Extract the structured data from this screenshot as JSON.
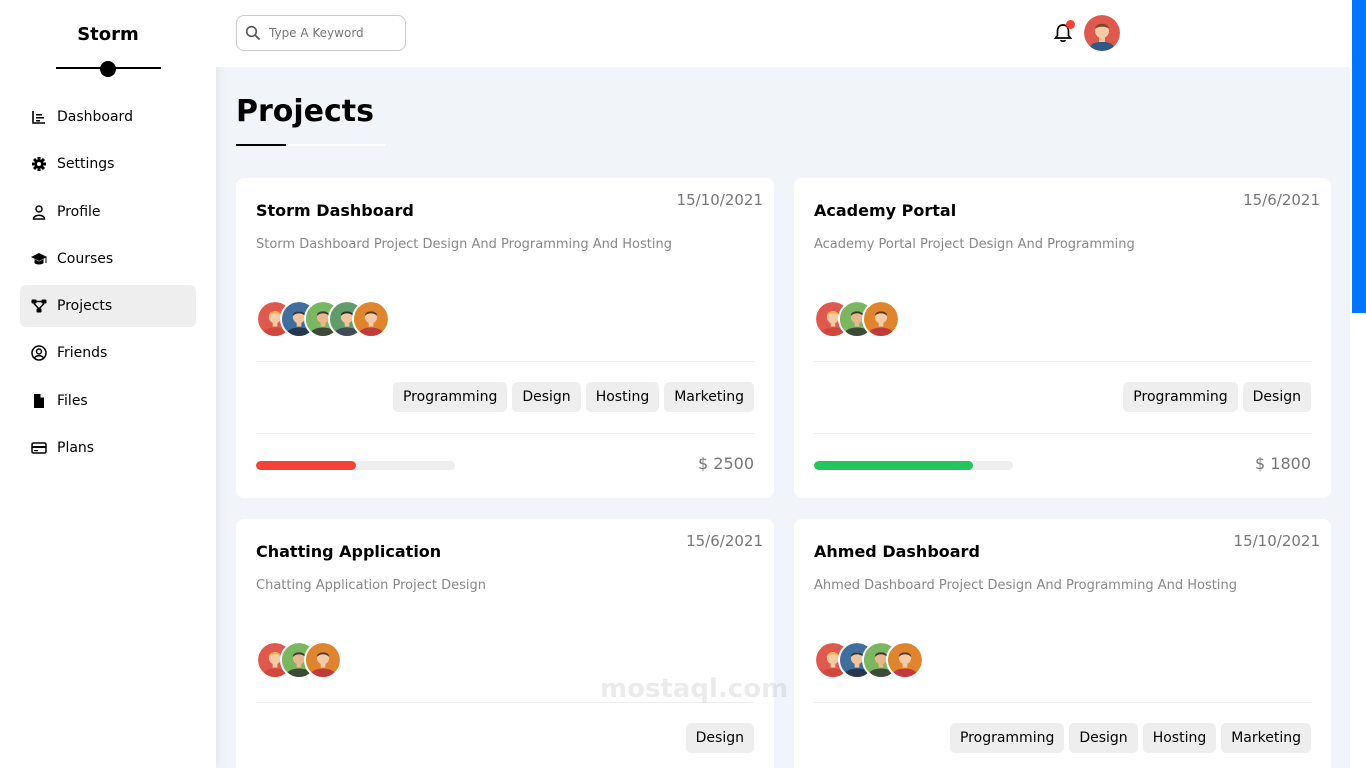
{
  "sidebar": {
    "brand": "Storm",
    "items": [
      {
        "label": "Dashboard",
        "icon": "chart-icon",
        "active": false
      },
      {
        "label": "Settings",
        "icon": "gear-icon",
        "active": false
      },
      {
        "label": "Profile",
        "icon": "user-icon",
        "active": false
      },
      {
        "label": "Courses",
        "icon": "graduation-cap-icon",
        "active": false
      },
      {
        "label": "Projects",
        "icon": "diagram-icon",
        "active": true
      },
      {
        "label": "Friends",
        "icon": "user-circle-icon",
        "active": false
      },
      {
        "label": "Files",
        "icon": "file-icon",
        "active": false
      },
      {
        "label": "Plans",
        "icon": "credit-card-icon",
        "active": false
      }
    ]
  },
  "header": {
    "search_placeholder": "Type A Keyword",
    "has_notification": true
  },
  "main": {
    "title": "Projects"
  },
  "projects": [
    {
      "title": "Storm Dashboard",
      "date": "15/10/2021",
      "description": "Storm Dashboard Project Design And Programming And Hosting",
      "team_size": 5,
      "tags": [
        "Programming",
        "Design",
        "Hosting",
        "Marketing"
      ],
      "progress": 0.5,
      "progress_color": "#f44336",
      "price": "2500"
    },
    {
      "title": "Academy Portal",
      "date": "15/6/2021",
      "description": "Academy Portal Project Design And Programming",
      "team_size": 3,
      "tags": [
        "Programming",
        "Design"
      ],
      "progress": 0.8,
      "progress_color": "#22c55e",
      "price": "1800"
    },
    {
      "title": "Chatting Application",
      "date": "15/6/2021",
      "description": "Chatting Application Project Design",
      "team_size": 3,
      "tags": [
        "Design"
      ],
      "progress": null,
      "progress_color": "",
      "price": ""
    },
    {
      "title": "Ahmed Dashboard",
      "date": "15/10/2021",
      "description": "Ahmed Dashboard Project Design And Programming And Hosting",
      "team_size": 4,
      "tags": [
        "Programming",
        "Design",
        "Hosting",
        "Marketing"
      ],
      "progress": null,
      "progress_color": "",
      "price": ""
    }
  ],
  "colors": {
    "accent": "#0075ff",
    "active_nav_bg": "#eeeeee",
    "page_bg": "#f1f5f9"
  }
}
